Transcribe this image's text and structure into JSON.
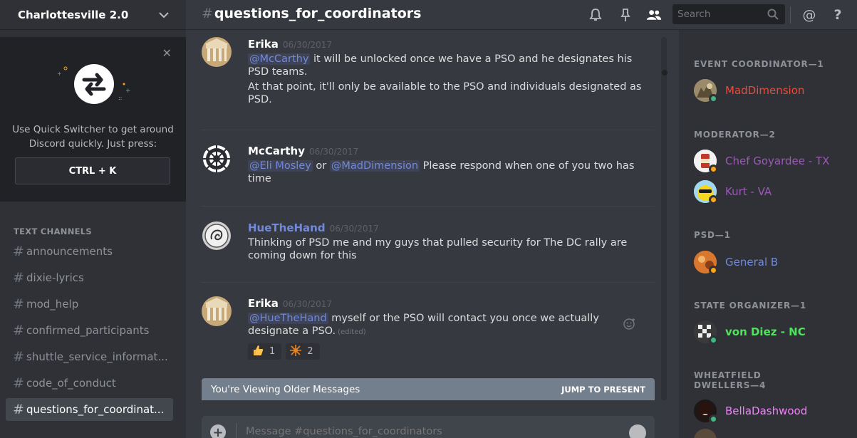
{
  "server": {
    "name": "Charlottesville 2.0"
  },
  "quick_switcher": {
    "text_line1": "Use Quick Switcher to get around",
    "text_line2": "Discord quickly. Just press:",
    "shortcut": "CTRL + K"
  },
  "channels": {
    "header": "TEXT CHANNELS",
    "items": [
      {
        "name": "announcements"
      },
      {
        "name": "dixie-lyrics"
      },
      {
        "name": "mod_help"
      },
      {
        "name": "confirmed_participants"
      },
      {
        "name": "shuttle_service_informat..."
      },
      {
        "name": "code_of_conduct"
      },
      {
        "name": "questions_for_coordinat...",
        "active": true
      }
    ]
  },
  "topbar": {
    "channel": "questions_for_coordinators",
    "search_placeholder": "Search",
    "help_glyph": "?",
    "mention_glyph": "@"
  },
  "messages": [
    {
      "author": "Erika",
      "timestamp": "06/30/2017",
      "mention": "@McCarthy",
      "text1": " it will be unlocked once we have a PSO and he designates his",
      "text1b": "PSD teams.",
      "text2": "At that point, it'll only be available to the PSO and individuals designated as",
      "text2b": "PSD."
    },
    {
      "author": "McCarthy",
      "timestamp": "06/30/2017",
      "mention1": "@Eli Mosley",
      "or": " or ",
      "mention2": "@MadDimension",
      "text1": "  Please respond when one of you two has",
      "text1b": "time"
    },
    {
      "author": "HueTheHand",
      "timestamp": "06/30/2017",
      "text1": "Thinking of PSD me and my guys that pulled security for The DC rally are",
      "text1b": "coming down for this"
    },
    {
      "author": "Erika",
      "timestamp": "06/30/2017",
      "mention": "@HueTheHand",
      "text1": "  myself or the PSO will contact you once we actually",
      "text1b": "designate a PSO.",
      "edited": "(edited)",
      "reactions": [
        {
          "icon": "thumbs-up-icon",
          "count": "1"
        },
        {
          "icon": "sun-cross-icon",
          "count": "2"
        }
      ]
    }
  ],
  "older_bar": {
    "text": "You're Viewing Older Messages",
    "jump": "JUMP TO PRESENT"
  },
  "composer": {
    "placeholder": "Message #questions_for_coordinators"
  },
  "members": {
    "groups": [
      {
        "role": "EVENT COORDINATOR—1",
        "members": [
          {
            "name": "MadDimension",
            "color": "#e74c3c",
            "status": "#43b581"
          }
        ]
      },
      {
        "role": "MODERATOR—2",
        "members": [
          {
            "name": "Chef Goyardee - TX",
            "color": "#9b59b6",
            "status": "#faa61a"
          },
          {
            "name": "Kurt - VA",
            "color": "#9b59b6",
            "status": "#faa61a"
          }
        ]
      },
      {
        "role": "PSD—1",
        "members": [
          {
            "name": "General B",
            "color": "#7289da",
            "status": "#faa61a"
          }
        ]
      },
      {
        "role": "STATE ORGANIZER—1",
        "members": [
          {
            "name": "von Diez - NC",
            "color": "#4fe55a",
            "status": "#43b581"
          }
        ]
      },
      {
        "role_line1": "WHEATFIELD",
        "role_line2": "DWELLERS—4",
        "members": [
          {
            "name": "BellaDashwood",
            "color": "#f47fff",
            "status": "#43b581"
          }
        ]
      }
    ]
  },
  "colors": {
    "blurple": "#7289da",
    "bg": "#36393f",
    "sidebar": "#2f3136"
  }
}
